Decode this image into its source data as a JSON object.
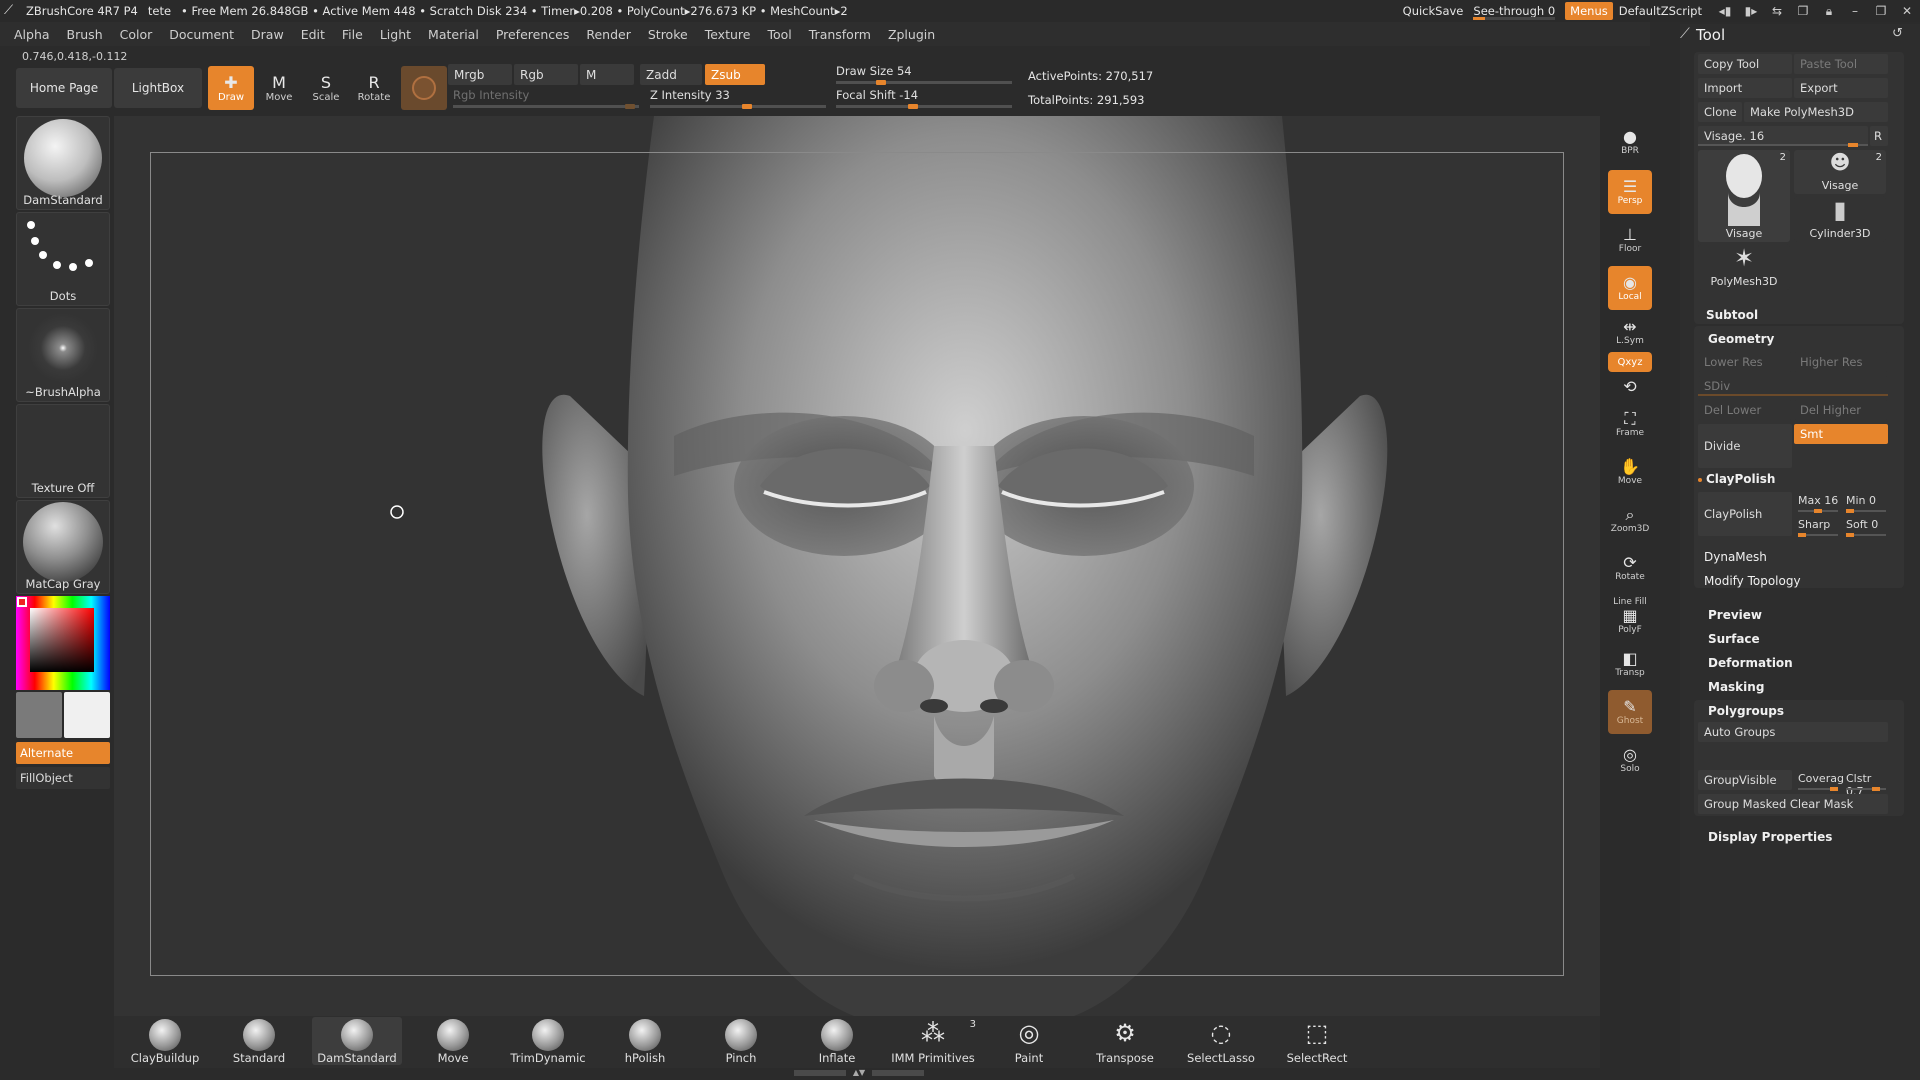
{
  "titlebar": {
    "app": "ZBrushCore 4R7 P4",
    "doc": "tete",
    "stats": "• Free Mem 26.848GB • Active Mem 448 • Scratch Disk 234 • Timer▸0.208 • PolyCount▸276.673 KP • MeshCount▸2",
    "quicksave": "QuickSave",
    "seethrough": "See-through  0",
    "menus": "Menus",
    "script": "DefaultZScript"
  },
  "menubar": [
    "Alpha",
    "Brush",
    "Color",
    "Document",
    "Draw",
    "Edit",
    "File",
    "Light",
    "Material",
    "Preferences",
    "Render",
    "Stroke",
    "Texture",
    "Tool",
    "Transform",
    "Zplugin"
  ],
  "coords": "0.746,0.418,-0.112",
  "toolbar": {
    "home": "Home Page",
    "lightbox": "LightBox",
    "draw": "Draw",
    "move": "Move",
    "scale": "Scale",
    "rotate": "Rotate",
    "mrgb": "Mrgb",
    "rgb": "Rgb",
    "m": "M",
    "zadd": "Zadd",
    "zsub": "Zsub",
    "rgb_intensity": "Rgb Intensity",
    "z_intensity": "Z Intensity 33",
    "draw_size": "Draw Size 54",
    "focal_shift": "Focal Shift -14",
    "active_points": "ActivePoints: 270,517",
    "total_points": "TotalPoints: 291,593"
  },
  "leftshelf": {
    "brush": "DamStandard",
    "stroke": "Dots",
    "alpha": "~BrushAlpha",
    "texture": "Texture Off",
    "material": "MatCap Gray",
    "alternate": "Alternate",
    "fillobject": "FillObject"
  },
  "rightdock": [
    "BPR",
    "Persp",
    "Floor",
    "Local",
    "L.Sym",
    "Qxyz",
    "Frame",
    "Move",
    "Zoom3D",
    "Rotate",
    "Line Fill",
    "PolyF",
    "Transp",
    "Ghost",
    "Solo"
  ],
  "toolpanel": {
    "title": "Tool",
    "copy_tool": "Copy Tool",
    "paste_tool": "Paste Tool",
    "import": "Import",
    "export": "Export",
    "clone": "Clone",
    "make_polymesh": "Make PolyMesh3D",
    "visage_slider": "Visage. 16",
    "r": "R",
    "tools": [
      {
        "name": "Visage",
        "count": "2"
      },
      {
        "name": "Visage",
        "count": "2"
      },
      {
        "name": "Cylinder3D",
        "count": ""
      },
      {
        "name": "PolyMesh3D",
        "count": ""
      }
    ],
    "subtool": "Subtool",
    "geometry": "Geometry",
    "lower_res": "Lower Res",
    "higher_res": "Higher Res",
    "sdiv": "SDiv",
    "del_lower": "Del Lower",
    "del_higher": "Del Higher",
    "divide": "Divide",
    "smt": "Smt",
    "claypolish_header": "ClayPolish",
    "claypolish": "ClayPolish",
    "max": "Max 16",
    "min": "Min 0",
    "sharp": "Sharp",
    "soft": "Soft 0",
    "dynamesh": "DynaMesh",
    "modify_topology": "Modify Topology",
    "preview": "Preview",
    "surface": "Surface",
    "deformation": "Deformation",
    "masking": "Masking",
    "polygroups": "Polygroups",
    "auto_groups": "Auto Groups",
    "group_visible": "GroupVisible",
    "coverage": "Coverag",
    "clstr": "Clstr 0.7",
    "group_masked": "Group Masked Clear Mask",
    "display_properties": "Display Properties"
  },
  "brushes": [
    {
      "name": "ClayBuildup",
      "count": ""
    },
    {
      "name": "Standard",
      "count": ""
    },
    {
      "name": "DamStandard",
      "count": ""
    },
    {
      "name": "Move",
      "count": ""
    },
    {
      "name": "TrimDynamic",
      "count": ""
    },
    {
      "name": "hPolish",
      "count": ""
    },
    {
      "name": "Pinch",
      "count": ""
    },
    {
      "name": "Inflate",
      "count": ""
    },
    {
      "name": "IMM Primitives",
      "count": "3"
    },
    {
      "name": "Paint",
      "count": ""
    },
    {
      "name": "Transpose",
      "count": ""
    },
    {
      "name": "SelectLasso",
      "count": ""
    },
    {
      "name": "SelectRect",
      "count": ""
    }
  ],
  "colors": {
    "accent": "#e7852c",
    "background": "#2b2b2b",
    "canvas": "#333333"
  }
}
